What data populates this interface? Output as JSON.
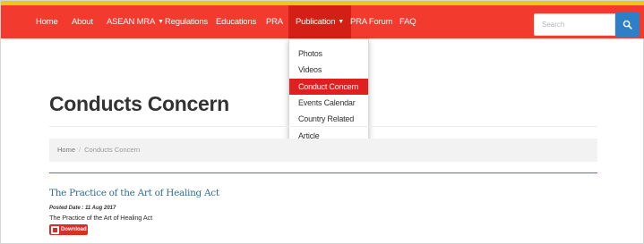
{
  "nav": {
    "items": [
      {
        "label": "Home"
      },
      {
        "label": "About"
      },
      {
        "label": "ASEAN MRA"
      },
      {
        "label": "Regulations"
      },
      {
        "label": "Educations"
      },
      {
        "label": "PRA"
      },
      {
        "label": "Publication"
      },
      {
        "label": "PRA Forum"
      },
      {
        "label": "FAQ"
      }
    ],
    "active": "Publication"
  },
  "search": {
    "placeholder": "Search"
  },
  "dropdown": {
    "items": [
      {
        "label": "Photos"
      },
      {
        "label": "Videos"
      },
      {
        "label": "Conduct Concern"
      },
      {
        "label": "Events Calendar"
      },
      {
        "label": "Country Related"
      },
      {
        "label": "Article"
      }
    ],
    "highlighted": "Conduct Concern"
  },
  "main": {
    "title": "Conducts Concern",
    "breadcrumb": {
      "home": "Home",
      "separator": "/",
      "current": "Conducts Concern"
    },
    "article": {
      "title": "The Practice of the Art of Healing Act",
      "posted_date": "Posted Date : 11 Aug 2017",
      "description": "The Practice of the Art of Healing Act",
      "download_label": "Download"
    }
  },
  "colors": {
    "top_strip": "#f4c21a",
    "navbar": "#f23a2e",
    "nav_active": "#d31f16",
    "search_button": "#2d7fc6",
    "dropdown_highlight": "#e01f1f",
    "article_title": "#2f6f8f",
    "download_button": "#d93025"
  },
  "icons": {
    "search": "search-icon",
    "caret": "caret-down-icon",
    "pdf": "pdf-icon"
  }
}
